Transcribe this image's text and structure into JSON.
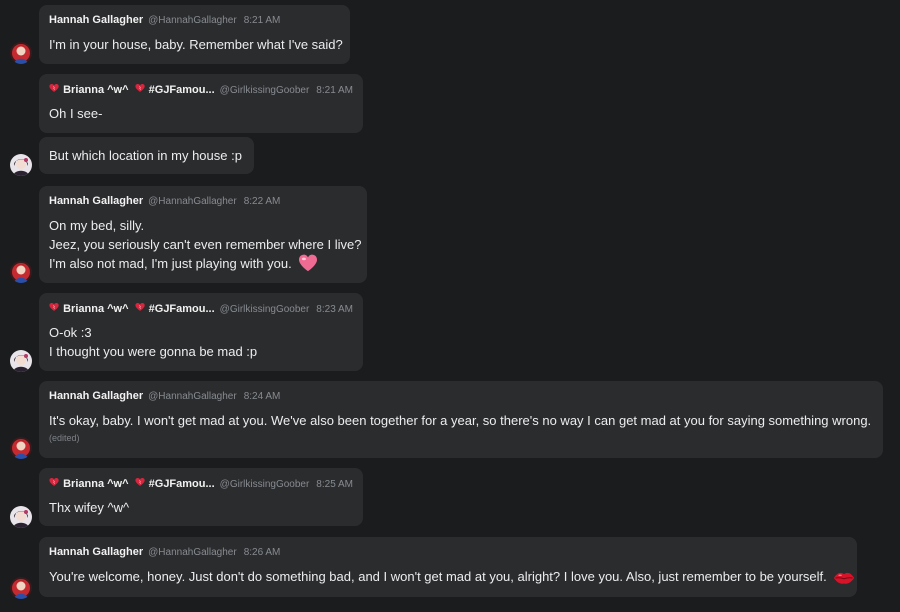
{
  "messages": [
    {
      "author": "Hannah Gallagher",
      "handle": "@HannahGallagher",
      "time": "8:21 AM",
      "lines": [
        "I'm in your house, baby. Remember what I've said?"
      ]
    },
    {
      "author": "Brianna ^w^",
      "author_tag": "#GJFamou...",
      "handle": "@GirlkissingGoober",
      "time": "8:21 AM",
      "lines": [
        "Oh I see-"
      ]
    },
    {
      "lines": [
        "But which location in my house :p"
      ]
    },
    {
      "author": "Hannah Gallagher",
      "handle": "@HannahGallagher",
      "time": "8:22 AM",
      "lines": [
        "On my bed, silly.",
        "Jeez, you seriously can't even remember where I live?",
        "I'm also not mad, I'm just playing with you."
      ],
      "emoji": "pink-heart"
    },
    {
      "author": "Brianna ^w^",
      "author_tag": "#GJFamou...",
      "handle": "@GirlkissingGoober",
      "time": "8:23 AM",
      "lines": [
        "O-ok :3",
        "I thought you were gonna be mad :p"
      ]
    },
    {
      "author": "Hannah Gallagher",
      "handle": "@HannahGallagher",
      "time": "8:24 AM",
      "lines": [
        "It's okay, baby. I won't get mad at you. We've also been together for a year, so there's no way I can get mad at you for saying something wrong."
      ],
      "edited": "(edited)"
    },
    {
      "author": "Brianna ^w^",
      "author_tag": "#GJFamou...",
      "handle": "@GirlkissingGoober",
      "time": "8:25 AM",
      "lines": [
        "Thx wifey ^w^"
      ]
    },
    {
      "author": "Hannah Gallagher",
      "handle": "@HannahGallagher",
      "time": "8:26 AM",
      "lines": [
        "You're welcome, honey. Just don't do something bad, and I won't get mad at you, alright? I love you. Also, just remember to be yourself."
      ],
      "emoji": "kiss-lips"
    }
  ],
  "colors": {
    "background": "#1b1c1d",
    "bubble": "#2b2c2e",
    "muted_text": "#878b90",
    "heart_red": "#d7263d"
  }
}
